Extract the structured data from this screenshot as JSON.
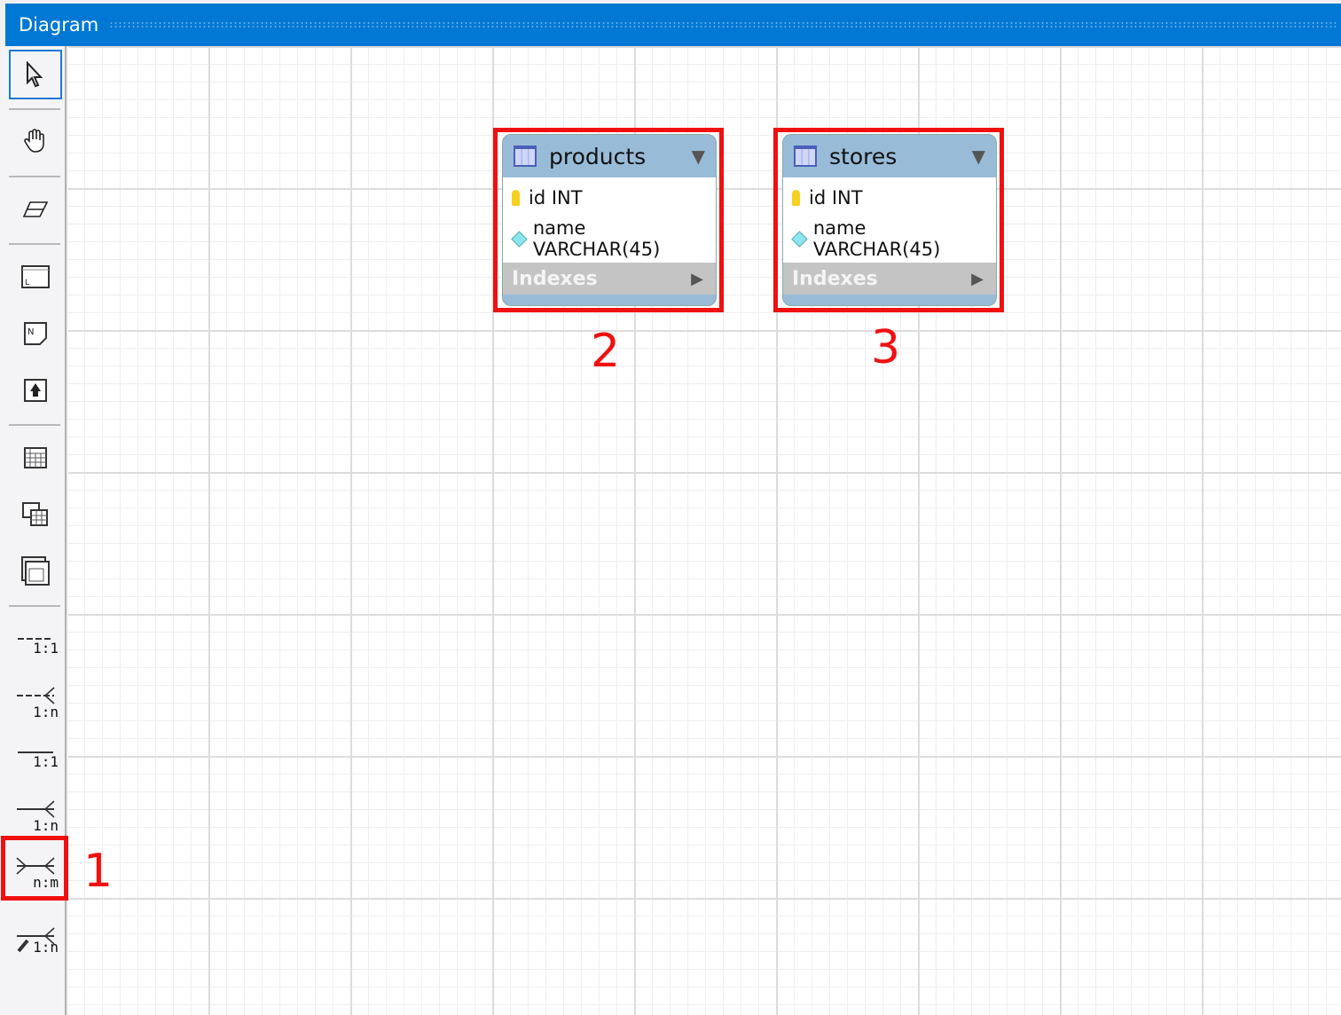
{
  "window": {
    "title": "Diagram"
  },
  "toolbar": {
    "tools": [
      {
        "name": "select",
        "icon": "pointer-icon"
      },
      {
        "name": "hand",
        "icon": "hand-icon"
      },
      {
        "name": "eraser",
        "icon": "eraser-icon"
      },
      {
        "name": "layer",
        "icon": "layer-icon"
      },
      {
        "name": "note",
        "icon": "note-icon"
      },
      {
        "name": "image",
        "icon": "image-icon"
      },
      {
        "name": "table",
        "icon": "table-icon"
      },
      {
        "name": "view",
        "icon": "view-icon"
      },
      {
        "name": "routine-group",
        "icon": "routine-group-icon"
      }
    ],
    "relations": [
      {
        "label": "1:1",
        "style": "dashed"
      },
      {
        "label": "1:n",
        "style": "dashed"
      },
      {
        "label": "1:1",
        "style": "solid"
      },
      {
        "label": "1:n",
        "style": "solid"
      },
      {
        "label": "n:m",
        "style": "solid"
      },
      {
        "label": "1:n",
        "style": "existing-columns"
      }
    ]
  },
  "tables": [
    {
      "name": "products",
      "columns": [
        {
          "text": "id INT",
          "icon": "primary-key-icon"
        },
        {
          "text": "name VARCHAR(45)",
          "icon": "column-diamond-icon"
        }
      ],
      "indexes": "Indexes"
    },
    {
      "name": "stores",
      "columns": [
        {
          "text": "id INT",
          "icon": "primary-key-icon"
        },
        {
          "text": "name VARCHAR(45)",
          "icon": "column-diamond-icon"
        }
      ],
      "indexes": "Indexes"
    }
  ],
  "annotations": [
    "1",
    "2",
    "3"
  ],
  "colors": {
    "titlebar": "#0078d4",
    "highlight": "#f01010",
    "table_header": "#98bcd8"
  }
}
